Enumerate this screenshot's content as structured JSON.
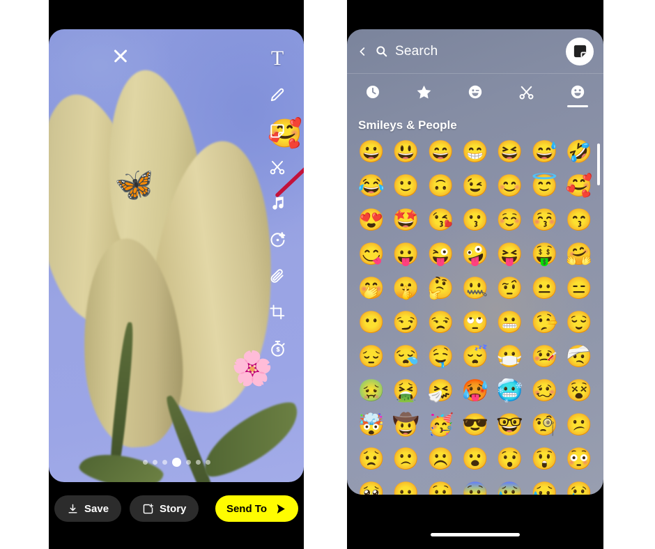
{
  "left_phone": {
    "name": "snapchat-editor",
    "close_icon": "close-icon",
    "stickers_on_canvas": [
      {
        "name": "butterfly-sticker",
        "glyph": "🦋"
      },
      {
        "name": "cherry-blossom-sticker",
        "glyph": "🌸"
      },
      {
        "name": "smiling-face-with-hearts-sticker",
        "glyph": "🥰"
      }
    ],
    "toolbar": [
      {
        "name": "text-tool",
        "label": "T",
        "icon": "text-icon"
      },
      {
        "name": "draw-tool",
        "label": "",
        "icon": "pencil-icon"
      },
      {
        "name": "sticker-tool",
        "label": "",
        "icon": "sticker-icon",
        "highlighted": true
      },
      {
        "name": "cutout-tool",
        "label": "",
        "icon": "scissors-icon"
      },
      {
        "name": "music-tool",
        "label": "",
        "icon": "music-note-icon"
      },
      {
        "name": "ai-lens-tool",
        "label": "",
        "icon": "magic-star-icon"
      },
      {
        "name": "attach-link-tool",
        "label": "",
        "icon": "paperclip-icon"
      },
      {
        "name": "crop-tool",
        "label": "",
        "icon": "crop-icon"
      },
      {
        "name": "timer-tool",
        "label": "",
        "icon": "timer-icon"
      }
    ],
    "annotation": {
      "type": "arrow",
      "color": "#c3123a",
      "points_to": "sticker-tool"
    },
    "page_dots": {
      "count": 7,
      "active_index": 3
    },
    "bottom_bar": {
      "save_label": "Save",
      "story_label": "Story",
      "send_label": "Send To",
      "send_color": "#fffc00"
    }
  },
  "right_phone": {
    "name": "sticker-picker",
    "header": {
      "back_icon": "chevron-left-icon",
      "search_icon": "search-icon",
      "search_placeholder": "Search",
      "sticker_button_icon": "sticker-icon"
    },
    "tabs": [
      {
        "name": "tab-recent",
        "icon": "clock-icon",
        "active": false
      },
      {
        "name": "tab-favorites",
        "icon": "star-icon",
        "active": false
      },
      {
        "name": "tab-stickers",
        "icon": "winking-sticker-icon",
        "active": false
      },
      {
        "name": "tab-cutouts",
        "icon": "scissors-icon",
        "active": false
      },
      {
        "name": "tab-emoji",
        "icon": "smiley-icon",
        "active": true
      }
    ],
    "section_title": "Smileys & People",
    "emoji_rows": [
      [
        "😀",
        "😃",
        "😄",
        "😁",
        "😆",
        "😅",
        "🤣"
      ],
      [
        "😂",
        "🙂",
        "🙃",
        "😉",
        "😊",
        "😇",
        "🥰"
      ],
      [
        "😍",
        "🤩",
        "😘",
        "😗",
        "☺️",
        "😚",
        "😙"
      ],
      [
        "😋",
        "😛",
        "😜",
        "🤪",
        "😝",
        "🤑",
        "🤗"
      ],
      [
        "🤭",
        "🤫",
        "🤔",
        "🤐",
        "🤨",
        "😐",
        "😑"
      ],
      [
        "😶",
        "😏",
        "😒",
        "🙄",
        "😬",
        "🤥",
        "😌"
      ],
      [
        "😔",
        "😪",
        "🤤",
        "😴",
        "😷",
        "🤒",
        "🤕"
      ],
      [
        "🤢",
        "🤮",
        "🤧",
        "🥵",
        "🥶",
        "🥴",
        "😵"
      ],
      [
        "🤯",
        "🤠",
        "🥳",
        "😎",
        "🤓",
        "🧐",
        "😕"
      ],
      [
        "😟",
        "🙁",
        "☹️",
        "😮",
        "😯",
        "😲",
        "😳"
      ],
      [
        "🥺",
        "😦",
        "😧",
        "😨",
        "😰",
        "😥",
        "😢"
      ]
    ]
  }
}
